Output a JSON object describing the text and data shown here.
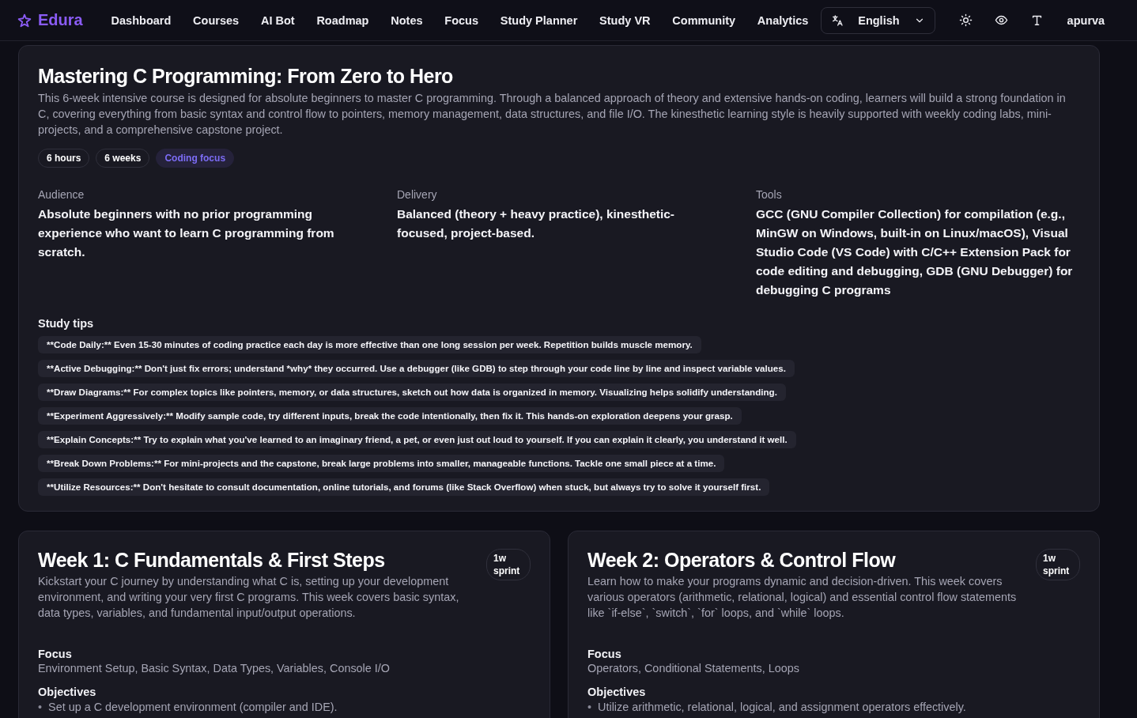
{
  "nav": {
    "brand": "Edura",
    "links": [
      "Dashboard",
      "Courses",
      "AI Bot",
      "Roadmap",
      "Notes",
      "Focus",
      "Study Planner",
      "Study VR",
      "Community",
      "Analytics"
    ],
    "language": "English",
    "user": "apurva"
  },
  "course": {
    "title": "Mastering C Programming: From Zero to Hero",
    "description": "This 6-week intensive course is designed for absolute beginners to master C programming. Through a balanced approach of theory and extensive hands-on coding, learners will build a strong foundation in C, covering everything from basic syntax and control flow to pointers, memory management, data structures, and file I/O. The kinesthetic learning style is heavily supported with weekly coding labs, mini-projects, and a comprehensive capstone project.",
    "tags": [
      {
        "label": "6 hours",
        "kind": "plain"
      },
      {
        "label": "6 weeks",
        "kind": "plain"
      },
      {
        "label": "Coding focus",
        "kind": "accent"
      }
    ],
    "details": [
      {
        "label": "Audience",
        "value": "Absolute beginners with no prior programming experience who want to learn C programming from scratch."
      },
      {
        "label": "Delivery",
        "value": "Balanced (theory + heavy practice), kinesthetic-focused, project-based."
      },
      {
        "label": "Tools",
        "value": "GCC (GNU Compiler Collection) for compilation (e.g., MinGW on Windows, built-in on Linux/macOS), Visual Studio Code (VS Code) with C/C++ Extension Pack for code editing and debugging, GDB (GNU Debugger) for debugging C programs"
      }
    ],
    "tips_heading": "Study tips",
    "tips": [
      "**Code Daily:** Even 15-30 minutes of coding practice each day is more effective than one long session per week. Repetition builds muscle memory.",
      "**Active Debugging:** Don't just fix errors; understand *why* they occurred. Use a debugger (like GDB) to step through your code line by line and inspect variable values.",
      "**Draw Diagrams:** For complex topics like pointers, memory, or data structures, sketch out how data is organized in memory. Visualizing helps solidify understanding.",
      "**Experiment Aggressively:** Modify sample code, try different inputs, break the code intentionally, then fix it. This hands-on exploration deepens your grasp.",
      "**Explain Concepts:** Try to explain what you've learned to an imaginary friend, a pet, or even just out loud to yourself. If you can explain it clearly, you understand it well.",
      "**Break Down Problems:** For mini-projects and the capstone, break large problems into smaller, manageable functions. Tackle one small piece at a time.",
      "**Utilize Resources:** Don't hesitate to consult documentation, online tutorials, and forums (like Stack Overflow) when stuck, but always try to solve it yourself first."
    ]
  },
  "weeks": [
    {
      "title": "Week 1: C Fundamentals & First Steps",
      "badge": "1w sprint",
      "description": "Kickstart your C journey by understanding what C is, setting up your development environment, and writing your very first C programs. This week covers basic syntax, data types, variables, and fundamental input/output operations.",
      "focus_label": "Focus",
      "focus": "Environment Setup, Basic Syntax, Data Types, Variables, Console I/O",
      "objectives_label": "Objectives",
      "objectives": [
        {
          "marker": "•",
          "text": "Set up a C development environment (compiler and IDE)."
        }
      ]
    },
    {
      "title": "Week 2: Operators & Control Flow",
      "badge": "1w sprint",
      "description": "Learn how to make your programs dynamic and decision-driven. This week covers various operators (arithmetic, relational, logical) and essential control flow statements like `if-else`, `switch`, `for` loops, and `while` loops.",
      "focus_label": "Focus",
      "focus": "Operators, Conditional Statements, Loops",
      "objectives_label": "Objectives",
      "objectives": [
        {
          "marker": "•",
          "text": "Utilize arithmetic, relational, logical, and assignment operators effectively."
        }
      ]
    }
  ]
}
